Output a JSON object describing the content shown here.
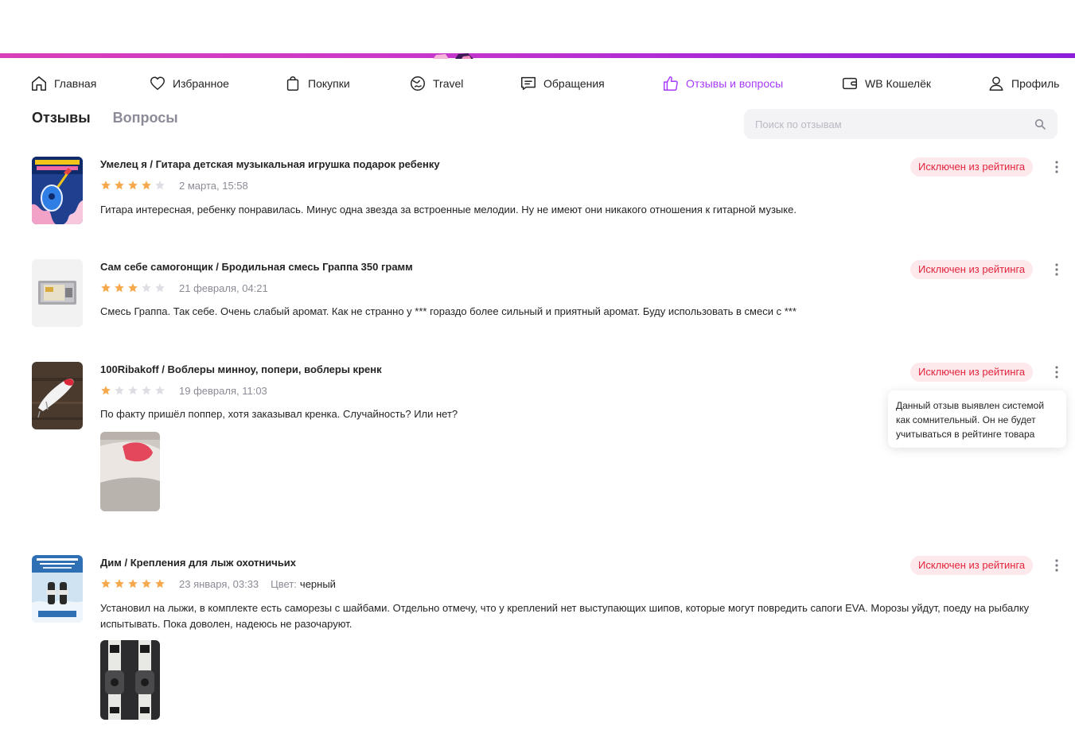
{
  "nav": {
    "items": [
      {
        "label": "Главная",
        "icon": "home-icon"
      },
      {
        "label": "Избранное",
        "icon": "heart-icon"
      },
      {
        "label": "Покупки",
        "icon": "bag-icon"
      },
      {
        "label": "Travel",
        "icon": "globe-icon"
      },
      {
        "label": "Обращения",
        "icon": "chat-icon"
      },
      {
        "label": "Отзывы и вопросы",
        "icon": "thumbs-up-icon",
        "active": true
      },
      {
        "label": "WB Кошелёк",
        "icon": "wallet-icon"
      },
      {
        "label": "Профиль",
        "icon": "user-icon"
      }
    ]
  },
  "tabs": [
    {
      "label": "Отзывы",
      "active": true
    },
    {
      "label": "Вопросы",
      "active": false
    }
  ],
  "search": {
    "placeholder": "Поиск по отзывам"
  },
  "excluded_badge": "Исключен из рейтинга",
  "tooltip": {
    "text": "Данный отзыв выявлен системой как сомнительный. Он не будет учитываться в рейтинге товара"
  },
  "reviews": [
    {
      "title": "Умелец я / Гитара детская музыкальная игрушка подарок ребенку",
      "rating": 4,
      "date": "2 марта, 15:58",
      "text": "Гитара интересная, ребенку понравилась. Минус одна звезда за встроенные мелодии. Ну не имеют они никакого отношения к гитарной музыке.",
      "badge": "Исключен из рейтинга"
    },
    {
      "title": "Сам себе самогонщик / Бродильная смесь Граппа 350 грамм",
      "rating": 3,
      "date": "21 февраля, 04:21",
      "text": "Смесь Граппа. Так себе. Очень слабый аромат. Как не странно у *** гораздо более сильный и приятный аромат. Буду использовать в смеси с ***",
      "badge": "Исключен из рейтинга"
    },
    {
      "title": "100Ribakoff / Воблеры минноу, попери, воблеры кренк",
      "rating": 1,
      "date": "19 февраля, 11:03",
      "text": "По факту пришёл поппер, хотя заказывал кренка. Случайность? Или нет?",
      "badge": "Исключен из рейтинга"
    },
    {
      "title": "Дим / Крепления для лыж охотничьих",
      "rating": 5,
      "date": "23 января, 03:33",
      "color_label": "Цвет:",
      "color_value": "черный",
      "text": "Установил на лыжи, в комплекте есть саморезы с шайбами. Отдельно отмечу, что у креплений нет выступающих шипов, которые могут повредить сапоги EVA. Морозы уйдут, поеду на рыбалку испытывать. Пока доволен, надеюсь не разочаруют.",
      "badge": "Исключен из рейтинга"
    }
  ],
  "colors": {
    "accent": "#a73afd",
    "badge_text": "#e3253c",
    "badge_bg": "#fde8ec",
    "star_filled": "#f6a94c",
    "star_empty": "#dedee4"
  }
}
